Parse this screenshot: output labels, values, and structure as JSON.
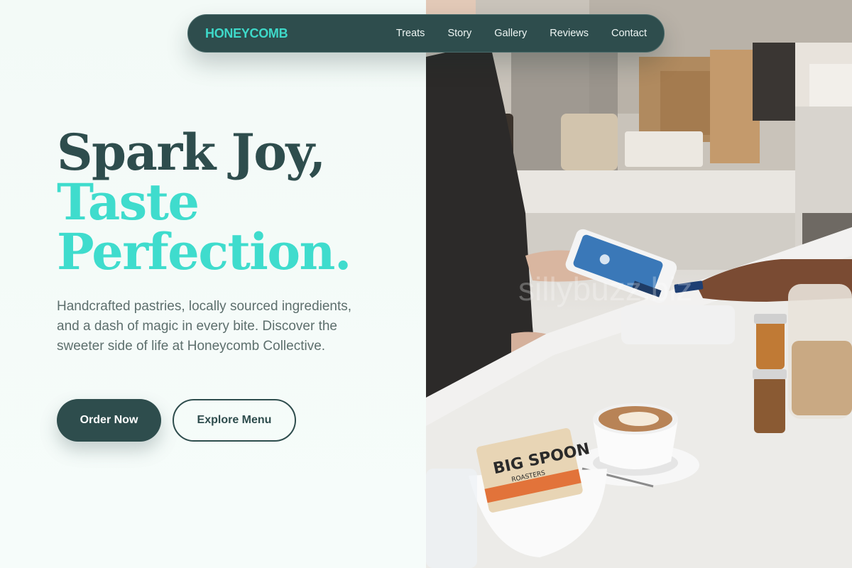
{
  "brand": {
    "name": "HONEYCOMB",
    "accent": "#3ed9c9",
    "dark": "#2e4d4d"
  },
  "nav": {
    "links": [
      "Treats",
      "Story",
      "Gallery",
      "Reviews",
      "Contact"
    ]
  },
  "hero": {
    "line1": "Spark Joy,",
    "line2": "Taste",
    "line3": "Perfection.",
    "subtext": "Handcrafted pastries, locally sourced ingredients, and a dash of magic in every bite. Discover the sweeter side of life at Honeycomb Collective.",
    "primary_cta": "Order Now",
    "secondary_cta": "Explore Menu"
  },
  "photo": {
    "subject": "cafe counter with card payment terminal, latte and snack pack",
    "watermark": "sillybuzz.biz",
    "pack_label": "BIG SPOON",
    "pack_sub": "ROASTERS"
  }
}
